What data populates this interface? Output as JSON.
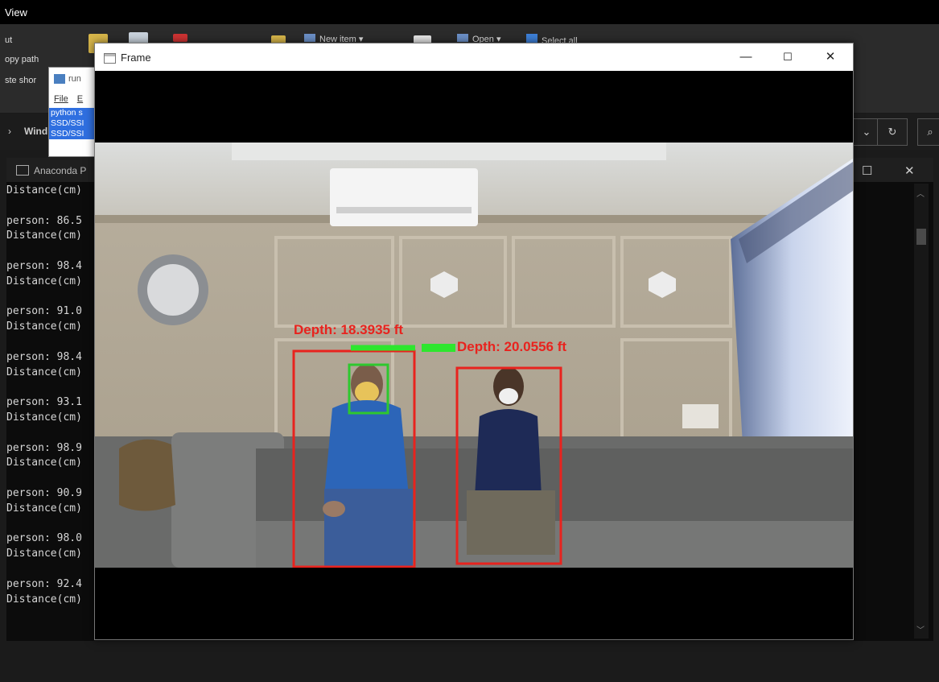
{
  "explorer": {
    "title": "View",
    "ribbon": {
      "cut": "ut",
      "copy_path": "opy path",
      "paste_shortcut": "ste shor",
      "new_item": "New item",
      "open": "Open",
      "select_all": "Select all"
    },
    "address_prefix": "Wind",
    "refresh_icon": "refresh-icon",
    "search_icon": "search-icon"
  },
  "notepad": {
    "title": "run",
    "menu_file": "File",
    "menu_edit": "E",
    "selected_lines": [
      "python s",
      "SSD/SSI",
      "SSD/SSI"
    ]
  },
  "anaconda": {
    "title": "Anaconda P",
    "console_lines": [
      "Distance(cm)",
      "",
      "person: 86.5",
      "Distance(cm)",
      "",
      "person: 98.4",
      "Distance(cm)",
      "",
      "person: 91.0",
      "Distance(cm)",
      "",
      "person: 98.4",
      "Distance(cm)",
      "",
      "person: 93.1",
      "Distance(cm)",
      "",
      "person: 98.9",
      "Distance(cm)",
      "",
      "person: 90.9",
      "Distance(cm)",
      "",
      "person: 98.0",
      "Distance(cm)",
      "",
      "person: 92.4",
      "Distance(cm)"
    ]
  },
  "frame": {
    "title": "Frame",
    "minimize": "—",
    "maximize": "☐",
    "close": "✕",
    "detections": {
      "person1_label": "Depth: 18.3935 ft",
      "person2_label": "Depth: 20.0556 ft"
    },
    "colors": {
      "detection_box": "#e8231e",
      "mask_box": "#2ec82e",
      "distance_line": "#2ee62e"
    }
  }
}
